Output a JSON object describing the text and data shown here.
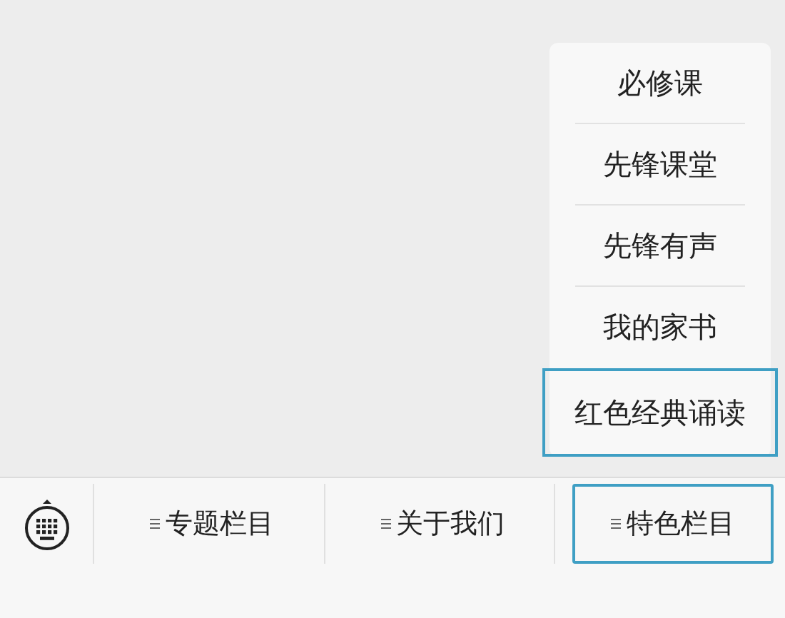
{
  "submenu": {
    "items": [
      {
        "label": "必修课",
        "selected": false
      },
      {
        "label": "先锋课堂",
        "selected": false
      },
      {
        "label": "先锋有声",
        "selected": false
      },
      {
        "label": "我的家书",
        "selected": false
      },
      {
        "label": "红色经典诵读",
        "selected": true
      }
    ]
  },
  "menu_bar": {
    "tabs": [
      {
        "label": "专题栏目",
        "selected": false
      },
      {
        "label": "关于我们",
        "selected": false
      },
      {
        "label": "特色栏目",
        "selected": true
      }
    ]
  }
}
